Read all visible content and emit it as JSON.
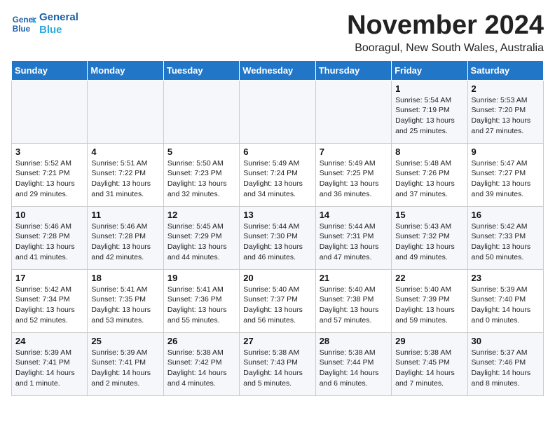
{
  "logo": {
    "text_general": "General",
    "text_blue": "Blue"
  },
  "header": {
    "month": "November 2024",
    "location": "Booragul, New South Wales, Australia"
  },
  "weekdays": [
    "Sunday",
    "Monday",
    "Tuesday",
    "Wednesday",
    "Thursday",
    "Friday",
    "Saturday"
  ],
  "weeks": [
    [
      {
        "day": "",
        "info": ""
      },
      {
        "day": "",
        "info": ""
      },
      {
        "day": "",
        "info": ""
      },
      {
        "day": "",
        "info": ""
      },
      {
        "day": "",
        "info": ""
      },
      {
        "day": "1",
        "info": "Sunrise: 5:54 AM\nSunset: 7:19 PM\nDaylight: 13 hours\nand 25 minutes."
      },
      {
        "day": "2",
        "info": "Sunrise: 5:53 AM\nSunset: 7:20 PM\nDaylight: 13 hours\nand 27 minutes."
      }
    ],
    [
      {
        "day": "3",
        "info": "Sunrise: 5:52 AM\nSunset: 7:21 PM\nDaylight: 13 hours\nand 29 minutes."
      },
      {
        "day": "4",
        "info": "Sunrise: 5:51 AM\nSunset: 7:22 PM\nDaylight: 13 hours\nand 31 minutes."
      },
      {
        "day": "5",
        "info": "Sunrise: 5:50 AM\nSunset: 7:23 PM\nDaylight: 13 hours\nand 32 minutes."
      },
      {
        "day": "6",
        "info": "Sunrise: 5:49 AM\nSunset: 7:24 PM\nDaylight: 13 hours\nand 34 minutes."
      },
      {
        "day": "7",
        "info": "Sunrise: 5:49 AM\nSunset: 7:25 PM\nDaylight: 13 hours\nand 36 minutes."
      },
      {
        "day": "8",
        "info": "Sunrise: 5:48 AM\nSunset: 7:26 PM\nDaylight: 13 hours\nand 37 minutes."
      },
      {
        "day": "9",
        "info": "Sunrise: 5:47 AM\nSunset: 7:27 PM\nDaylight: 13 hours\nand 39 minutes."
      }
    ],
    [
      {
        "day": "10",
        "info": "Sunrise: 5:46 AM\nSunset: 7:28 PM\nDaylight: 13 hours\nand 41 minutes."
      },
      {
        "day": "11",
        "info": "Sunrise: 5:46 AM\nSunset: 7:28 PM\nDaylight: 13 hours\nand 42 minutes."
      },
      {
        "day": "12",
        "info": "Sunrise: 5:45 AM\nSunset: 7:29 PM\nDaylight: 13 hours\nand 44 minutes."
      },
      {
        "day": "13",
        "info": "Sunrise: 5:44 AM\nSunset: 7:30 PM\nDaylight: 13 hours\nand 46 minutes."
      },
      {
        "day": "14",
        "info": "Sunrise: 5:44 AM\nSunset: 7:31 PM\nDaylight: 13 hours\nand 47 minutes."
      },
      {
        "day": "15",
        "info": "Sunrise: 5:43 AM\nSunset: 7:32 PM\nDaylight: 13 hours\nand 49 minutes."
      },
      {
        "day": "16",
        "info": "Sunrise: 5:42 AM\nSunset: 7:33 PM\nDaylight: 13 hours\nand 50 minutes."
      }
    ],
    [
      {
        "day": "17",
        "info": "Sunrise: 5:42 AM\nSunset: 7:34 PM\nDaylight: 13 hours\nand 52 minutes."
      },
      {
        "day": "18",
        "info": "Sunrise: 5:41 AM\nSunset: 7:35 PM\nDaylight: 13 hours\nand 53 minutes."
      },
      {
        "day": "19",
        "info": "Sunrise: 5:41 AM\nSunset: 7:36 PM\nDaylight: 13 hours\nand 55 minutes."
      },
      {
        "day": "20",
        "info": "Sunrise: 5:40 AM\nSunset: 7:37 PM\nDaylight: 13 hours\nand 56 minutes."
      },
      {
        "day": "21",
        "info": "Sunrise: 5:40 AM\nSunset: 7:38 PM\nDaylight: 13 hours\nand 57 minutes."
      },
      {
        "day": "22",
        "info": "Sunrise: 5:40 AM\nSunset: 7:39 PM\nDaylight: 13 hours\nand 59 minutes."
      },
      {
        "day": "23",
        "info": "Sunrise: 5:39 AM\nSunset: 7:40 PM\nDaylight: 14 hours\nand 0 minutes."
      }
    ],
    [
      {
        "day": "24",
        "info": "Sunrise: 5:39 AM\nSunset: 7:41 PM\nDaylight: 14 hours\nand 1 minute."
      },
      {
        "day": "25",
        "info": "Sunrise: 5:39 AM\nSunset: 7:41 PM\nDaylight: 14 hours\nand 2 minutes."
      },
      {
        "day": "26",
        "info": "Sunrise: 5:38 AM\nSunset: 7:42 PM\nDaylight: 14 hours\nand 4 minutes."
      },
      {
        "day": "27",
        "info": "Sunrise: 5:38 AM\nSunset: 7:43 PM\nDaylight: 14 hours\nand 5 minutes."
      },
      {
        "day": "28",
        "info": "Sunrise: 5:38 AM\nSunset: 7:44 PM\nDaylight: 14 hours\nand 6 minutes."
      },
      {
        "day": "29",
        "info": "Sunrise: 5:38 AM\nSunset: 7:45 PM\nDaylight: 14 hours\nand 7 minutes."
      },
      {
        "day": "30",
        "info": "Sunrise: 5:37 AM\nSunset: 7:46 PM\nDaylight: 14 hours\nand 8 minutes."
      }
    ]
  ]
}
